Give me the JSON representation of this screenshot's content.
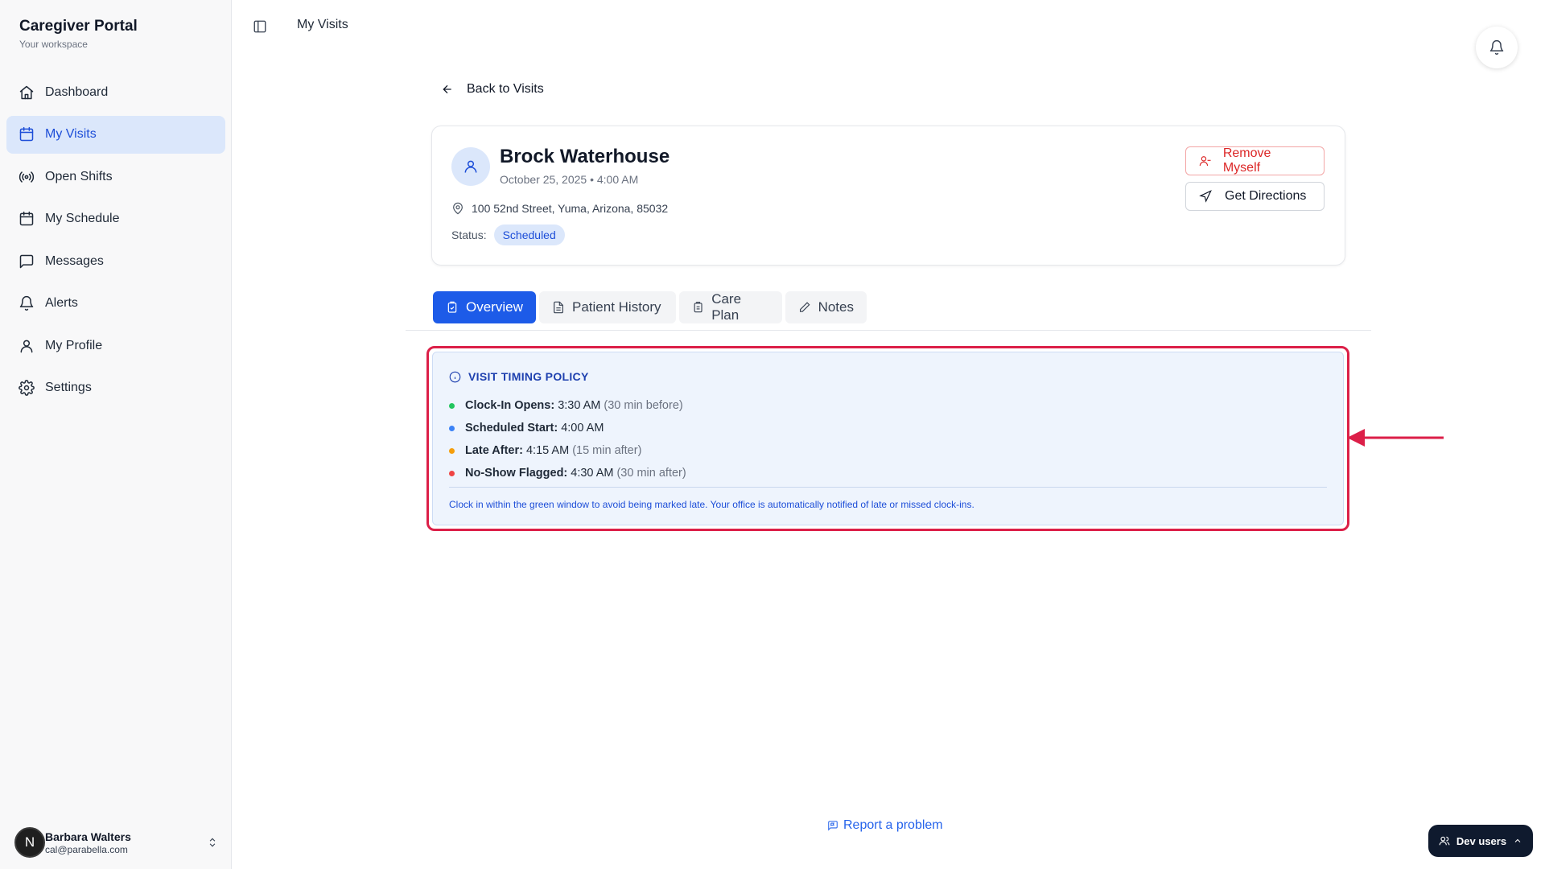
{
  "app": {
    "title": "Caregiver Portal",
    "subtitle": "Your workspace"
  },
  "sidebar": {
    "items": [
      {
        "label": "Dashboard",
        "icon": "home-icon",
        "active": false
      },
      {
        "label": "My Visits",
        "icon": "calendar-icon",
        "active": true
      },
      {
        "label": "Open Shifts",
        "icon": "broadcast-icon",
        "active": false
      },
      {
        "label": "My Schedule",
        "icon": "calendar-icon",
        "active": false
      },
      {
        "label": "Messages",
        "icon": "message-square-icon",
        "active": false
      },
      {
        "label": "Alerts",
        "icon": "bell-icon",
        "active": false
      },
      {
        "label": "My Profile",
        "icon": "user-icon",
        "active": false
      },
      {
        "label": "Settings",
        "icon": "gear-icon",
        "active": false
      }
    ],
    "user": {
      "initial": "N",
      "name": "Barbara Walters",
      "email": "cal@parabella.com"
    }
  },
  "header": {
    "page_title": "My Visits"
  },
  "back_link": {
    "label": "Back to Visits"
  },
  "visit": {
    "patient_name": "Brock Waterhouse",
    "datetime": "October 25, 2025 • 4:00 AM",
    "address": "100 52nd Street, Yuma, Arizona, 85032",
    "status_label": "Status:",
    "status": "Scheduled",
    "remove_label": "Remove Myself",
    "directions_label": "Get Directions"
  },
  "tabs": [
    {
      "label": "Overview",
      "active": true
    },
    {
      "label": "Patient History",
      "active": false
    },
    {
      "label": "Care Plan",
      "active": false
    },
    {
      "label": "Notes",
      "active": false
    }
  ],
  "policy": {
    "title": "VISIT TIMING POLICY",
    "rows": [
      {
        "label": "Clock-In Opens:",
        "value": "3:30 AM",
        "note": "(30 min before)",
        "color": "#22c55e"
      },
      {
        "label": "Scheduled Start:",
        "value": "4:00 AM",
        "note": "",
        "color": "#3b82f6"
      },
      {
        "label": "Late After:",
        "value": "4:15 AM",
        "note": "(15 min after)",
        "color": "#f59e0b"
      },
      {
        "label": "No-Show Flagged:",
        "value": "4:30 AM",
        "note": "(30 min after)",
        "color": "#ef4444"
      }
    ],
    "footer": "Clock in within the green window to avoid being marked late. Your office is automatically notified of late or missed clock-ins."
  },
  "footer": {
    "report_label": "Report a problem",
    "dev_users_label": "Dev users"
  },
  "colors": {
    "accent": "#1d5be8",
    "annotation": "#dc1f48"
  }
}
